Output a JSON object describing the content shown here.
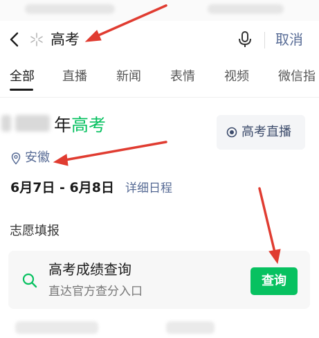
{
  "search": {
    "query": "高考",
    "cancel_label": "取消"
  },
  "tabs": [
    {
      "label": "全部",
      "active": true
    },
    {
      "label": "直播",
      "active": false
    },
    {
      "label": "新闻",
      "active": false
    },
    {
      "label": "表情",
      "active": false
    },
    {
      "label": "视频",
      "active": false
    },
    {
      "label": "微信指",
      "active": false
    }
  ],
  "card": {
    "title_prefix": "年",
    "title_highlight": "高考",
    "live_button_label": "高考直播",
    "location": "安徽",
    "dates": "6月7日 - 6月8日",
    "schedule_link": "详细日程"
  },
  "section": {
    "title": "志愿填报"
  },
  "result": {
    "title": "高考成绩查询",
    "subtitle": "直达官方查分入口",
    "button_label": "查询"
  },
  "colors": {
    "accent_green": "#07c160",
    "link_blue": "#576b95",
    "annotation_red": "#e03c31"
  },
  "icons": [
    "back-icon",
    "star-icon",
    "mic-icon",
    "live-icon",
    "pin-icon",
    "search-icon"
  ]
}
